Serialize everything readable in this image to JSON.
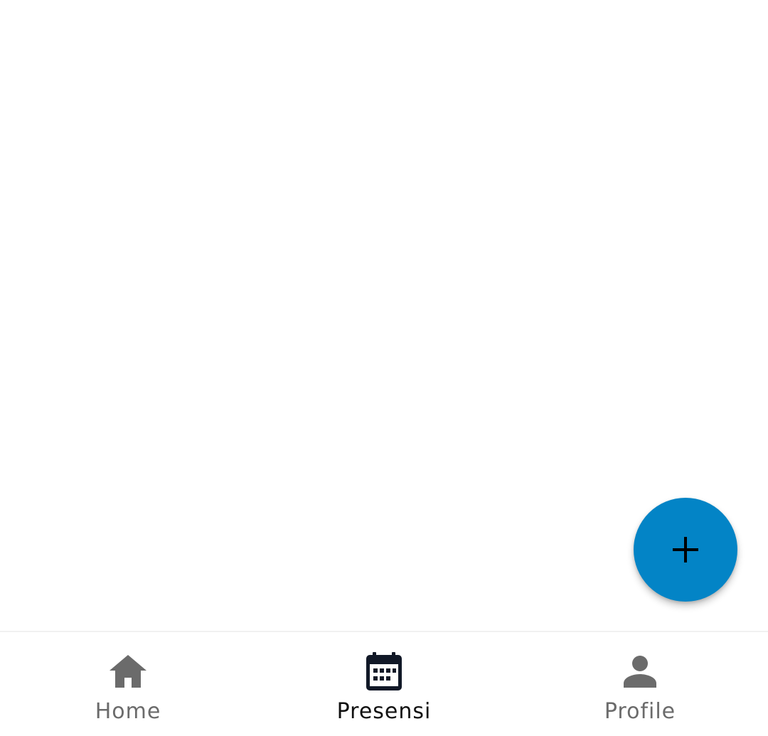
{
  "colors": {
    "fab_background": "#0384c6",
    "fab_icon": "#000000",
    "nav_active": "#111827",
    "nav_inactive": "#6b6b6b"
  },
  "fab": {
    "icon": "plus-icon"
  },
  "bottom_nav": {
    "items": [
      {
        "label": "Home",
        "icon": "home-icon",
        "active": false
      },
      {
        "label": "Presensi",
        "icon": "calendar-icon",
        "active": true
      },
      {
        "label": "Profile",
        "icon": "person-icon",
        "active": false
      }
    ]
  }
}
